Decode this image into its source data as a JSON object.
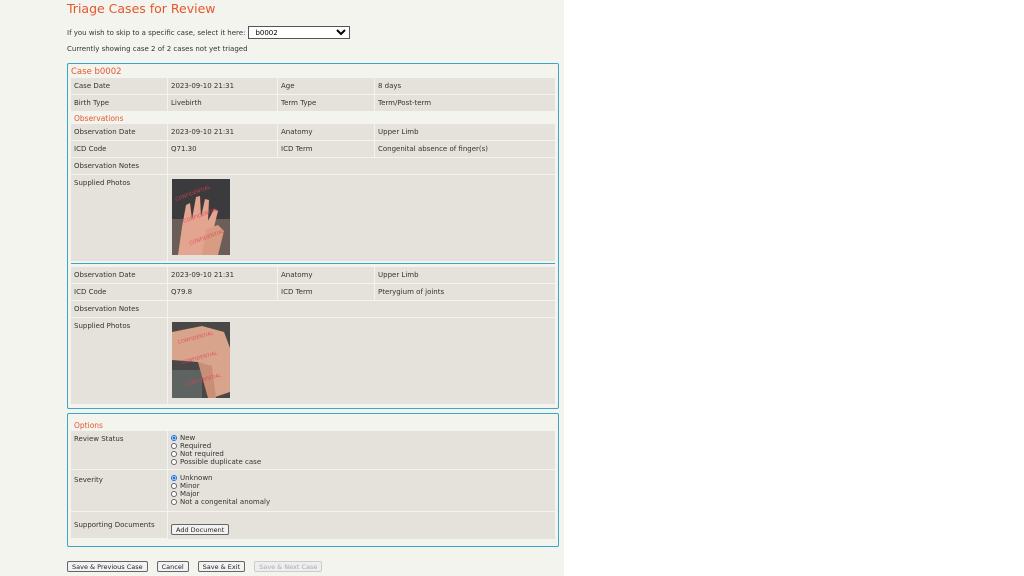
{
  "header": {
    "title": "Triage Cases for Review"
  },
  "skip": {
    "label": "If you wish to skip to a specific case, select it here:",
    "selected": "b0002"
  },
  "status_text": "Currently showing case 2 of 2 cases not yet triaged",
  "case": {
    "title": "Case b0002",
    "fields": {
      "case_date_label": "Case Date",
      "case_date": "2023-09-10 21:31",
      "age_label": "Age",
      "age": "8 days",
      "birth_type_label": "Birth Type",
      "birth_type": "Livebirth",
      "term_type_label": "Term Type",
      "term_type": "Term/Post-term"
    },
    "observations_label": "Observations",
    "observations": [
      {
        "date_label": "Observation Date",
        "date": "2023-09-10 21:31",
        "anatomy_label": "Anatomy",
        "anatomy": "Upper Limb",
        "icd_code_label": "ICD Code",
        "icd_code": "Q71.30",
        "icd_term_label": "ICD Term",
        "icd_term": "Congenital absence of finger(s)",
        "notes_label": "Observation Notes",
        "notes": "",
        "photos_label": "Supplied Photos"
      },
      {
        "date_label": "Observation Date",
        "date": "2023-09-10 21:31",
        "anatomy_label": "Anatomy",
        "anatomy": "Upper Limb",
        "icd_code_label": "ICD Code",
        "icd_code": "Q79.8",
        "icd_term_label": "ICD Term",
        "icd_term": "Pterygium of joints",
        "notes_label": "Observation Notes",
        "notes": "",
        "photos_label": "Supplied Photos"
      }
    ]
  },
  "options": {
    "title": "Options",
    "review_status_label": "Review Status",
    "review_status": [
      "New",
      "Required",
      "Not required",
      "Possible duplicate case"
    ],
    "severity_label": "Severity",
    "severity": [
      "Unknown",
      "Minor",
      "Major",
      "Not a congenital anomaly"
    ],
    "supporting_label": "Supporting Documents",
    "add_document": "Add Document"
  },
  "buttons": {
    "save_prev": "Save & Previous Case",
    "cancel": "Cancel",
    "save_exit": "Save & Exit",
    "save_next": "Save & Next Case"
  }
}
